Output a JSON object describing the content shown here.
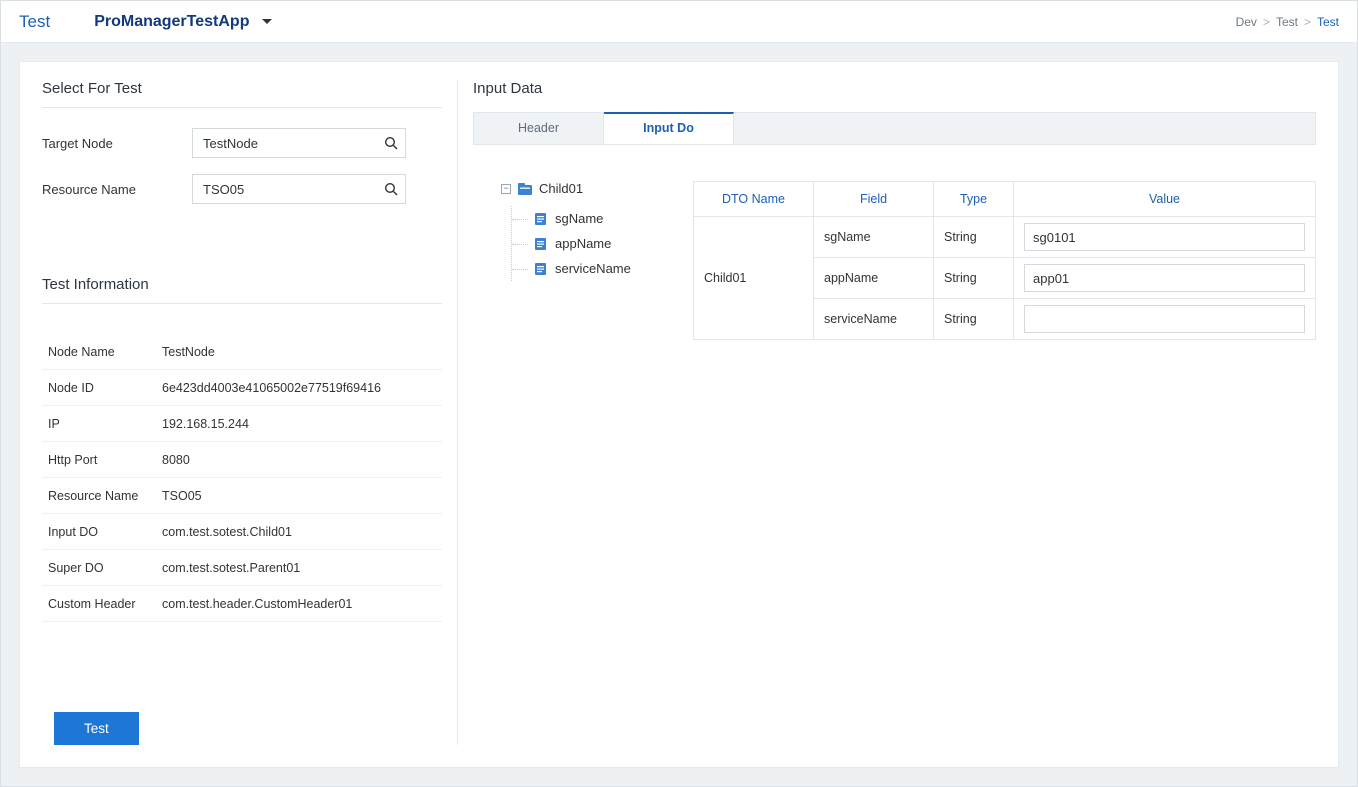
{
  "topbar": {
    "title": "Test",
    "app_name": "ProManagerTestApp",
    "breadcrumb": {
      "level1": "Dev",
      "level2": "Test",
      "level3": "Test"
    }
  },
  "left": {
    "select_title": "Select For Test",
    "target_node_label": "Target Node",
    "target_node_value": "TestNode",
    "resource_name_label": "Resource Name",
    "resource_name_value": "TSO05",
    "info_title": "Test Information",
    "info": {
      "node_name_label": "Node Name",
      "node_name_value": "TestNode",
      "node_id_label": "Node ID",
      "node_id_value": "6e423dd4003e41065002e77519f69416",
      "ip_label": "IP",
      "ip_value": "192.168.15.244",
      "http_port_label": "Http Port",
      "http_port_value": "8080",
      "resource_name_label": "Resource Name",
      "resource_name_value": "TSO05",
      "input_do_label": "Input DO",
      "input_do_value": "com.test.sotest.Child01",
      "super_do_label": "Super DO",
      "super_do_value": "com.test.sotest.Parent01",
      "custom_header_label": "Custom Header",
      "custom_header_value": "com.test.header.CustomHeader01"
    },
    "test_button": "Test"
  },
  "right": {
    "title": "Input Data",
    "tabs": {
      "header": "Header",
      "input_do": "Input Do"
    },
    "tree": {
      "root": "Child01",
      "children": [
        "sgName",
        "appName",
        "serviceName"
      ]
    },
    "table": {
      "headers": {
        "dto_name": "DTO  Name",
        "field": "Field",
        "type": "Type",
        "value": "Value"
      },
      "dto_name": "Child01",
      "rows": [
        {
          "field": "sgName",
          "type": "String",
          "value": "sg0101"
        },
        {
          "field": "appName",
          "type": "String",
          "value": "app01"
        },
        {
          "field": "serviceName",
          "type": "String",
          "value": ""
        }
      ]
    }
  }
}
